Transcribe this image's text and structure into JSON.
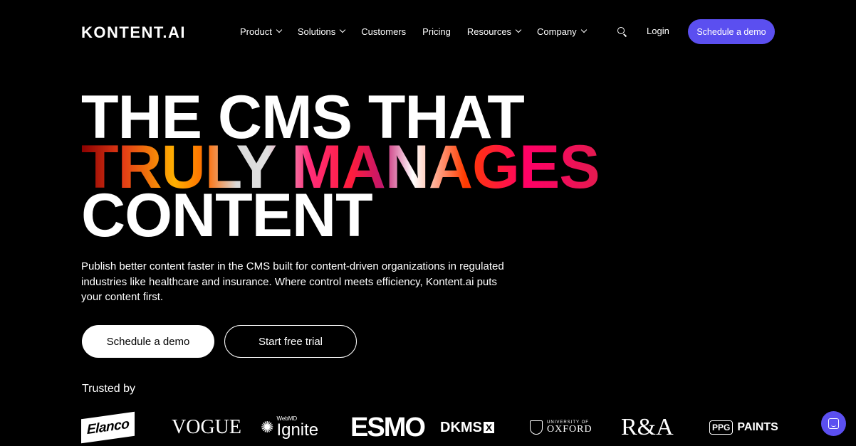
{
  "header": {
    "logo": "KONTENT.AI",
    "nav": [
      {
        "label": "Product",
        "dropdown": true
      },
      {
        "label": "Solutions",
        "dropdown": true
      },
      {
        "label": "Customers",
        "dropdown": false
      },
      {
        "label": "Pricing",
        "dropdown": false
      },
      {
        "label": "Resources",
        "dropdown": true
      },
      {
        "label": "Company",
        "dropdown": true
      }
    ],
    "search_icon": "search-icon",
    "login": "Login",
    "cta": "Schedule a demo",
    "accent_color": "#5b4ff0"
  },
  "hero": {
    "line1": "THE CMS THAT",
    "line2": "TRULY MANAGES",
    "line3": "CONTENT",
    "subtitle": "Publish better content faster in the CMS built for content-driven organizations in regulated industries like healthcare and insurance. Where control meets efficiency, Kontent.ai puts your content first.",
    "primary_button": "Schedule a demo",
    "secondary_button": "Start free trial"
  },
  "trusted": {
    "label": "Trusted by",
    "logos": {
      "elanco": "Elanco",
      "vogue": "VOGUE",
      "ignite_small": "WebMD",
      "ignite_big": "Ignite",
      "esmo": "ESMO",
      "dkms": "DKMS",
      "dkms_x": "X",
      "oxford_small": "UNIVERSITY OF",
      "oxford_big": "OXFORD",
      "ra": "R&A",
      "ppg_mark": "PPG",
      "ppg_text": "PAINTS"
    }
  },
  "chat": {
    "icon": "chat-icon"
  }
}
